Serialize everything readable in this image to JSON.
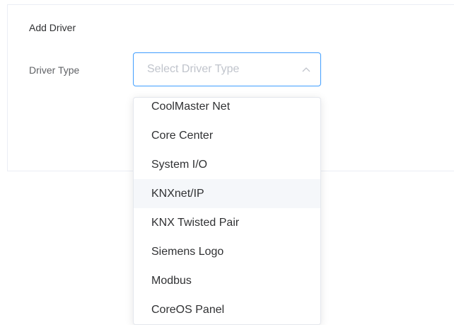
{
  "card": {
    "title": "Add Driver"
  },
  "form": {
    "driver_type_label": "Driver Type",
    "select": {
      "placeholder": "Select Driver Type",
      "expanded": true
    }
  },
  "dropdown": {
    "options": [
      {
        "label": "CoolMaster Net"
      },
      {
        "label": "Core Center"
      },
      {
        "label": "System I/O"
      },
      {
        "label": "KNXnet/IP",
        "hovered": true
      },
      {
        "label": "KNX Twisted Pair"
      },
      {
        "label": "Siemens Logo"
      },
      {
        "label": "Modbus"
      },
      {
        "label": "CoreOS Panel"
      }
    ]
  },
  "colors": {
    "accent": "#409eff",
    "hover_bg": "#f5f7fa",
    "placeholder": "#c0c4cc"
  },
  "icons": {
    "select_arrow": "chevron-up-icon"
  }
}
